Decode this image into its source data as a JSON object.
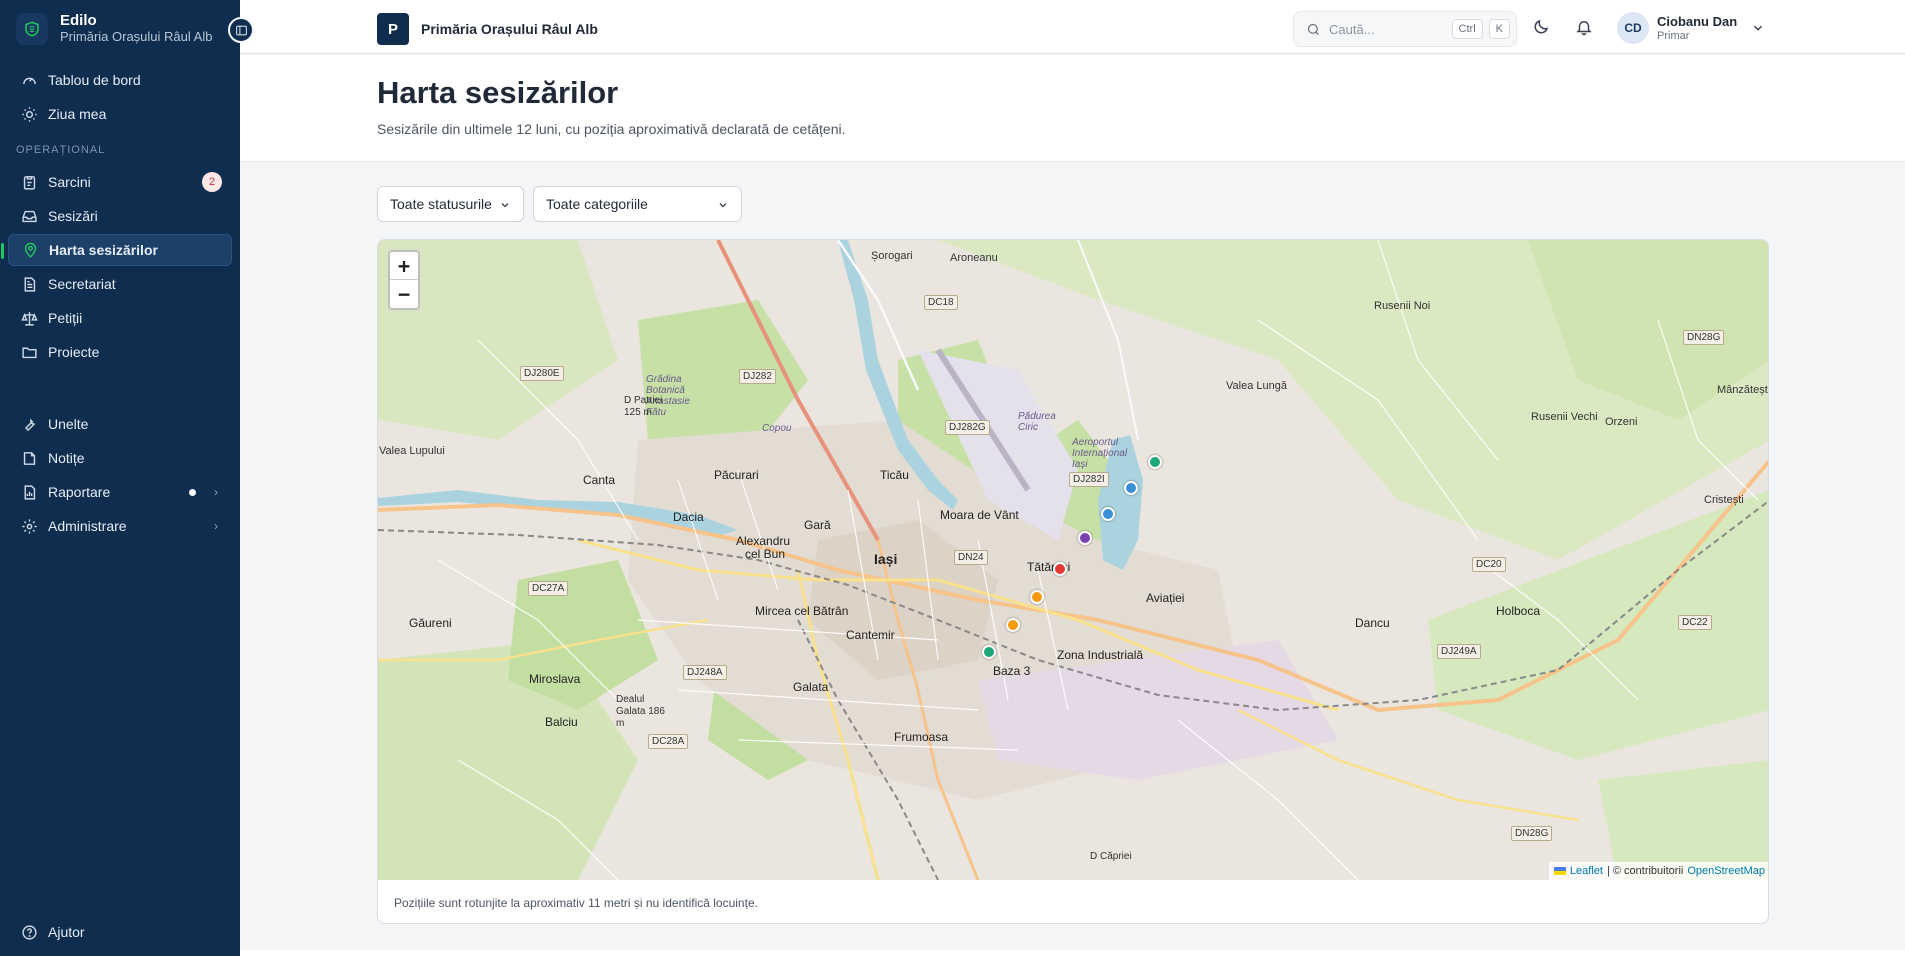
{
  "sidebar": {
    "brand_title": "Edilo",
    "brand_subtitle": "Primăria Orașului Râul Alb",
    "top_items": [
      {
        "label": "Tablou de bord",
        "icon": "gauge-icon"
      },
      {
        "label": "Ziua mea",
        "icon": "sun-icon"
      }
    ],
    "section_label": "OPERAȚIONAL",
    "ops_items": [
      {
        "label": "Sarcini",
        "icon": "clipboard-icon",
        "badge": "2"
      },
      {
        "label": "Sesizări",
        "icon": "inbox-icon"
      },
      {
        "label": "Harta sesizărilor",
        "icon": "map-pin-icon",
        "active": true
      },
      {
        "label": "Secretariat",
        "icon": "document-icon"
      },
      {
        "label": "Petiții",
        "icon": "scale-icon"
      },
      {
        "label": "Proiecte",
        "icon": "folder-icon"
      }
    ],
    "tool_items": [
      {
        "label": "Unelte",
        "icon": "wrench-icon"
      },
      {
        "label": "Notițe",
        "icon": "note-icon"
      },
      {
        "label": "Raportare",
        "icon": "report-icon",
        "dot": true,
        "chevron": true
      },
      {
        "label": "Administrare",
        "icon": "gear-icon",
        "chevron": true
      }
    ],
    "help_label": "Ajutor"
  },
  "topbar": {
    "org_initial": "P",
    "org_name": "Primăria Orașului Râul Alb",
    "search_placeholder": "Caută...",
    "kbd_ctrl": "Ctrl",
    "kbd_k": "K",
    "user_initials": "CD",
    "user_name": "Ciobanu Dan",
    "user_role": "Primar"
  },
  "page": {
    "title": "Harta sesizărilor",
    "subtitle": "Sesizările din ultimele 12 luni, cu poziția aproximativă declarată de cetățeni."
  },
  "filters": {
    "status": "Toate statusurile",
    "category": "Toate categoriile"
  },
  "map": {
    "zoom_in": "+",
    "zoom_out": "−",
    "attribution_leaflet": "Leaflet",
    "attribution_sep": "| © contribuitorii",
    "attribution_osm": "OpenStreetMap",
    "note": "Pozițiile sunt rotunjite la aproximativ 11 metri și nu identifică locuințe.",
    "colors": {
      "green": "#1fa67a",
      "blue": "#3b8fd9",
      "purple": "#7b3fb0",
      "red": "#e53935",
      "orange": "#f29b12"
    },
    "place_labels": {
      "sorogari": "Șorogari",
      "aroneanu": "Aroneanu",
      "rusenii_noi": "Rusenii Noi",
      "valea_lunga": "Valea Lungă",
      "rusenii_vechi": "Rusenii Vechi",
      "orzeni": "Orzeni",
      "manzatesti": "Mânzătești",
      "cristesti": "Cristești",
      "valea_lupului": "Valea Lupului",
      "pacurari": "Păcurari",
      "canta": "Canta",
      "ticau": "Ticău",
      "moara_de_vant": "Moara de Vânt",
      "dacia": "Dacia",
      "alexandru": "Alexandru",
      "cel_bun": "cel Bun",
      "gara": "Gară",
      "iasi": "Iași",
      "tatarasi": "Tătărași",
      "aviatiei": "Aviației",
      "dancu": "Dancu",
      "holboca": "Holboca",
      "gaureni": "Găureni",
      "mircea": "Mircea cel Bătrân",
      "cantemir": "Cantemir",
      "zona_industriala": "Zona Industrială",
      "baza3": "Baza 3",
      "miroslava": "Miroslava",
      "galata": "Galata",
      "balciu": "Balciu",
      "frumoasa": "Frumoasa",
      "copou": "Copou",
      "gradina": "Grădina Botanică Anastasie Fătu",
      "aeroportul": "Aeroportul Internațional Iași",
      "d_patriei": "D Patriei 125 m",
      "dealul_galata": "Dealul Galata 186 m",
      "d_capriei": "D Căpriei",
      "padurea_ciric": "Pădurea Ciric"
    },
    "road_labels": {
      "dc18": "DC18",
      "dj282": "DJ282",
      "dj280e": "DJ280E",
      "dj282g": "DJ282G",
      "dj282i": "DJ282I",
      "dn24": "DN24",
      "dn28g": "DN28G",
      "dn28g2": "DN28G",
      "dc20": "DC20",
      "dc22": "DC22",
      "dc27a": "DC27A",
      "dj248a": "DJ248A",
      "dc28a": "DC28A",
      "dj249a": "DJ249A"
    }
  }
}
